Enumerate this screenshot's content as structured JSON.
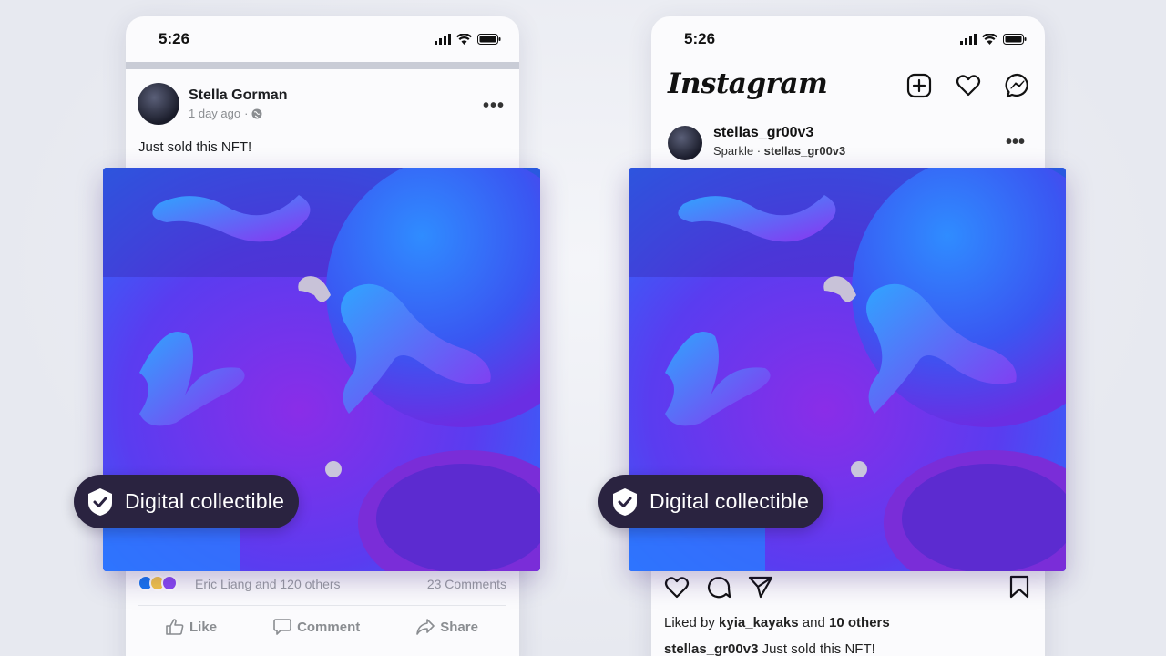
{
  "facebook": {
    "time": "5:26",
    "name": "Stella Gorman",
    "time_ago": "1 day ago",
    "separator": "·",
    "caption": "Just sold this NFT!",
    "likes_text": "Eric Liang and 120 others",
    "comments_text": "23 Comments",
    "actions": {
      "like": "Like",
      "comment": "Comment",
      "share": "Share"
    }
  },
  "instagram": {
    "time": "5:26",
    "logo": "Instagram",
    "username": "stellas_gr00v3",
    "sub_app": "Sparkle",
    "sub_separator": " · ",
    "sub_user": "stellas_gr00v3",
    "liked_prefix": "Liked by ",
    "liked_user": "kyia_kayaks",
    "liked_middle": " and ",
    "liked_count": "10 others",
    "caption_user": "stellas_gr00v3",
    "caption_text": " Just sold this NFT!"
  },
  "badge": {
    "label": "Digital collectible"
  },
  "colors": {
    "badge_bg": "#2a2340",
    "art_blue": "#1673ff",
    "art_purple": "#7a2de0",
    "fb_like_blue": "#1877f2"
  },
  "icons": [
    "signal-icon",
    "wifi-icon",
    "battery-icon",
    "globe-icon",
    "more-icon",
    "like-icon",
    "comment-icon",
    "share-icon",
    "add-post-icon",
    "heart-icon",
    "messenger-icon",
    "send-icon",
    "bookmark-icon",
    "shield-check-icon"
  ]
}
